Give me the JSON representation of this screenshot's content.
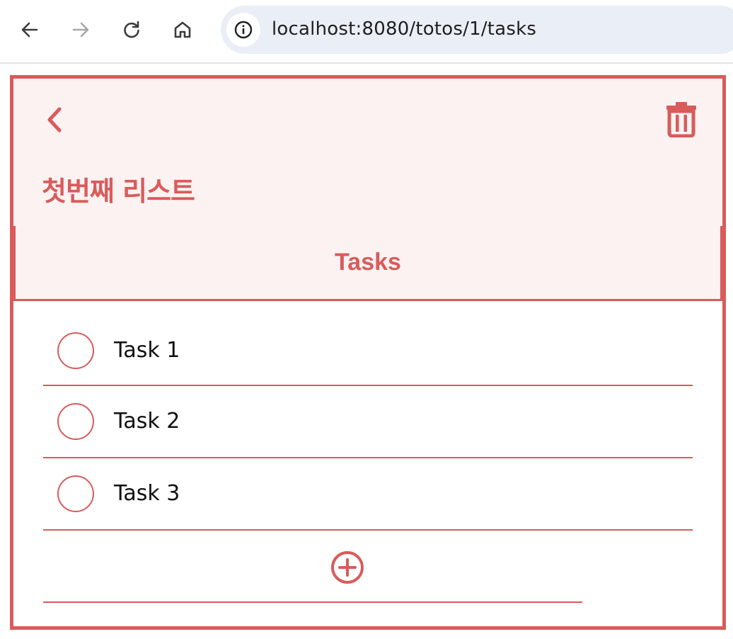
{
  "browser": {
    "url": "localhost:8080/totos/1/tasks"
  },
  "header": {
    "title": "첫번째 리스트"
  },
  "tab": {
    "label": "Tasks"
  },
  "tasks": [
    {
      "label": "Task 1",
      "done": false
    },
    {
      "label": "Task 2",
      "done": false
    },
    {
      "label": "Task 3",
      "done": false
    }
  ],
  "colors": {
    "accent": "#d95b5b",
    "header_bg": "#fcf2f2"
  },
  "icons": {
    "back": "chevron-left-icon",
    "delete": "trash-icon",
    "add": "plus-circle-icon"
  }
}
